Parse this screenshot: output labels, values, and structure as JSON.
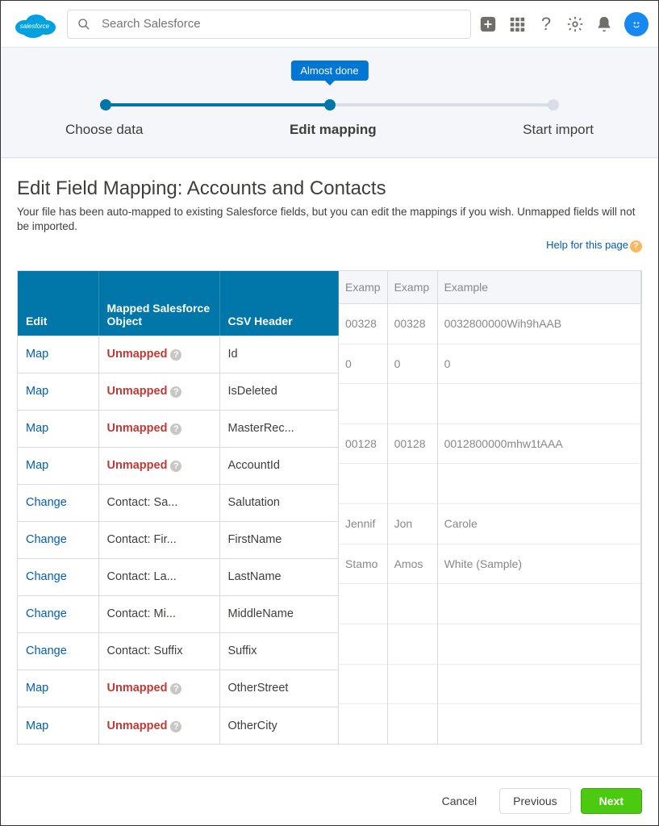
{
  "header": {
    "search_placeholder": "Search Salesforce"
  },
  "wizard": {
    "tooltip": "Almost done",
    "steps": [
      "Choose data",
      "Edit mapping",
      "Start import"
    ],
    "active_index": 1
  },
  "page": {
    "title": "Edit Field Mapping: Accounts and Contacts",
    "subtitle": "Your file has been auto-mapped to existing Salesforce fields, but you can edit the mappings if you wish. Unmapped fields will not be imported.",
    "help_label": "Help for this page"
  },
  "mapping": {
    "headers": {
      "edit": "Edit",
      "object": "Mapped Salesforce Object",
      "csv": "CSV Header"
    },
    "rows": [
      {
        "edit": "Map",
        "object_text": "Unmapped",
        "unmapped": true,
        "csv": "Id"
      },
      {
        "edit": "Map",
        "object_text": "Unmapped",
        "unmapped": true,
        "csv": "IsDeleted"
      },
      {
        "edit": "Map",
        "object_text": "Unmapped",
        "unmapped": true,
        "csv": "MasterRec..."
      },
      {
        "edit": "Map",
        "object_text": "Unmapped",
        "unmapped": true,
        "csv": "AccountId"
      },
      {
        "edit": "Change",
        "object_text": "Contact: Sa...",
        "unmapped": false,
        "csv": "Salutation"
      },
      {
        "edit": "Change",
        "object_text": "Contact: Fir...",
        "unmapped": false,
        "csv": "FirstName"
      },
      {
        "edit": "Change",
        "object_text": "Contact: La...",
        "unmapped": false,
        "csv": "LastName"
      },
      {
        "edit": "Change",
        "object_text": "Contact: Mi...",
        "unmapped": false,
        "csv": "MiddleName"
      },
      {
        "edit": "Change",
        "object_text": "Contact: Suffix",
        "unmapped": false,
        "csv": "Suffix"
      },
      {
        "edit": "Map",
        "object_text": "Unmapped",
        "unmapped": true,
        "csv": "OtherStreet"
      },
      {
        "edit": "Map",
        "object_text": "Unmapped",
        "unmapped": true,
        "csv": "OtherCity"
      }
    ]
  },
  "examples": {
    "headers": [
      "Examp",
      "Examp",
      "Example"
    ],
    "rows": [
      [
        "00328",
        "00328",
        "0032800000Wih9hAAB"
      ],
      [
        "0",
        "0",
        "0"
      ],
      [
        "",
        "",
        ""
      ],
      [
        "00128",
        "00128",
        "0012800000mhw1tAAA"
      ],
      [
        "",
        "",
        ""
      ],
      [
        "Jennif",
        "Jon",
        "Carole"
      ],
      [
        "Stamo",
        "Amos",
        "White (Sample)"
      ],
      [
        "",
        "",
        ""
      ],
      [
        "",
        "",
        ""
      ],
      [
        "",
        "",
        ""
      ],
      [
        "",
        "",
        ""
      ]
    ]
  },
  "footer": {
    "cancel": "Cancel",
    "previous": "Previous",
    "next": "Next"
  }
}
